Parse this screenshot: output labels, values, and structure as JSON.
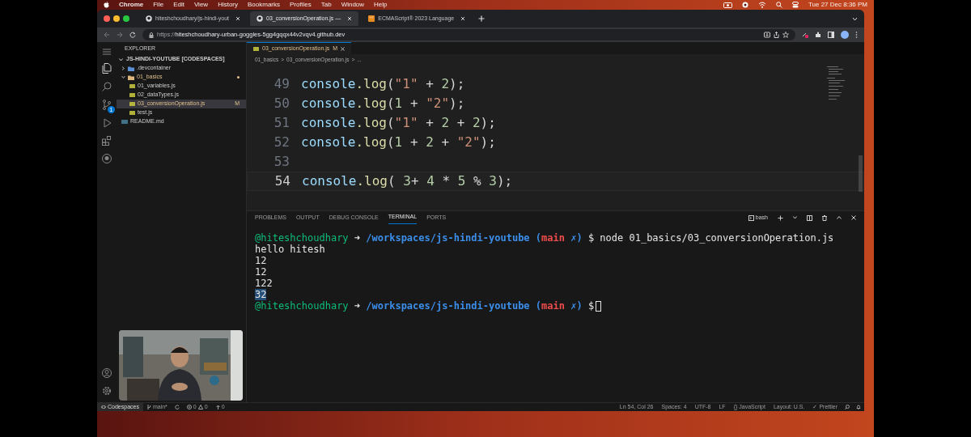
{
  "menu_bar": {
    "app": "Chrome",
    "items": [
      "File",
      "Edit",
      "View",
      "History",
      "Bookmarks",
      "Profiles",
      "Tab",
      "Window",
      "Help"
    ],
    "clock": "Tue 27 Dec  8:36 PM"
  },
  "browser": {
    "tabs": [
      {
        "title": "hiteshchoudhary/js-hindi-yout",
        "selected": false,
        "kind": "github"
      },
      {
        "title": "03_conversionOperation.js —",
        "selected": true,
        "kind": "github"
      },
      {
        "title": "ECMAScript® 2023 Language",
        "selected": false,
        "kind": "ecma"
      }
    ],
    "url_prefix": "https://",
    "url_host": "hiteshchoudhary-urban-goggles-5gg4gqqx44v2vqv4.github.dev"
  },
  "explorer": {
    "title": "EXPLORER",
    "root": "JS-HINDI-YOUTUBE [CODESPACES]",
    "items": [
      {
        "label": ".devcontainer",
        "kind": "folder",
        "expanded": false,
        "selected": false
      },
      {
        "label": "01_basics",
        "kind": "folder",
        "expanded": true,
        "selected": false,
        "modified_dot": true,
        "children": [
          {
            "label": "01_variables.js",
            "kind": "js",
            "selected": false
          },
          {
            "label": "02_dataTypes.js",
            "kind": "js",
            "selected": false
          },
          {
            "label": "03_conversionOperation.js",
            "kind": "js",
            "selected": true,
            "badge": "M"
          },
          {
            "label": "test.js",
            "kind": "js",
            "selected": false
          }
        ]
      },
      {
        "label": "README.md",
        "kind": "md",
        "selected": false
      }
    ]
  },
  "editor": {
    "tab": {
      "title": "03_conversionOperation.js",
      "badge": "M"
    },
    "breadcrumb": [
      "01_basics",
      ">",
      "03_conversionOperation.js",
      ">",
      "..."
    ],
    "lines": [
      {
        "number": "49",
        "code": "console.log(\"1\" + 2);",
        "current": false
      },
      {
        "number": "50",
        "code": "console.log(1 + \"2\");",
        "current": false
      },
      {
        "number": "51",
        "code": "console.log(\"1\" + 2 + 2);",
        "current": false
      },
      {
        "number": "52",
        "code": "console.log(1 + 2 + \"2\");",
        "current": false
      },
      {
        "number": "53",
        "current": false
      },
      {
        "number": "54",
        "code": "console.log( 3+ 4 * 5 % 3);",
        "current": true
      }
    ]
  },
  "panel": {
    "tabs": [
      {
        "label": "PROBLEMS",
        "selected": false
      },
      {
        "label": "OUTPUT",
        "selected": false
      },
      {
        "label": "DEBUG CONSOLE",
        "selected": false
      },
      {
        "label": "TERMINAL",
        "selected": true
      },
      {
        "label": "PORTS",
        "selected": false
      }
    ],
    "shell": "bash",
    "terminal": [
      {
        "kind": "prompt",
        "segments": [
          {
            "text": "@hiteshchoudhary",
            "kind": "user"
          },
          {
            "text": "➜",
            "kind": "plain"
          },
          {
            "text": "/workspaces/js-hindi-youtube",
            "kind": "path"
          },
          {
            "text": "(",
            "kind": "paren"
          },
          {
            "text": "main",
            "kind": "branch"
          },
          {
            "text": "✗)",
            "kind": "paren"
          },
          {
            "text": "$ node 01_basics/03_conversionOperation.js",
            "kind": "plain"
          }
        ]
      },
      {
        "kind": "output",
        "text": "hello hitesh",
        "selected": false
      },
      {
        "kind": "output",
        "text": "12",
        "selected": false
      },
      {
        "kind": "output",
        "text": "12",
        "selected": false
      },
      {
        "kind": "output",
        "text": "122",
        "selected": false
      },
      {
        "kind": "output",
        "text": "32",
        "selected": true
      },
      {
        "kind": "prompt",
        "cursor": true,
        "segments": [
          {
            "text": "@hiteshchoudhary",
            "kind": "user"
          },
          {
            "text": "➜",
            "kind": "plain"
          },
          {
            "text": "/workspaces/js-hindi-youtube",
            "kind": "path"
          },
          {
            "text": "(",
            "kind": "paren"
          },
          {
            "text": "main",
            "kind": "branch"
          },
          {
            "text": "✗)",
            "kind": "paren"
          },
          {
            "text": "$",
            "kind": "plain"
          }
        ]
      }
    ]
  },
  "status_bar": {
    "remote": "Codespaces",
    "branch": "main*",
    "errors": "0",
    "warnings": "0",
    "ports": "0",
    "right": [
      "Ln 54, Col 26",
      "Spaces: 4",
      "UTF-8",
      "LF",
      "{} JavaScript",
      "Layout: U.S.",
      "✓ Prettier"
    ]
  },
  "source_control_badge": "1"
}
